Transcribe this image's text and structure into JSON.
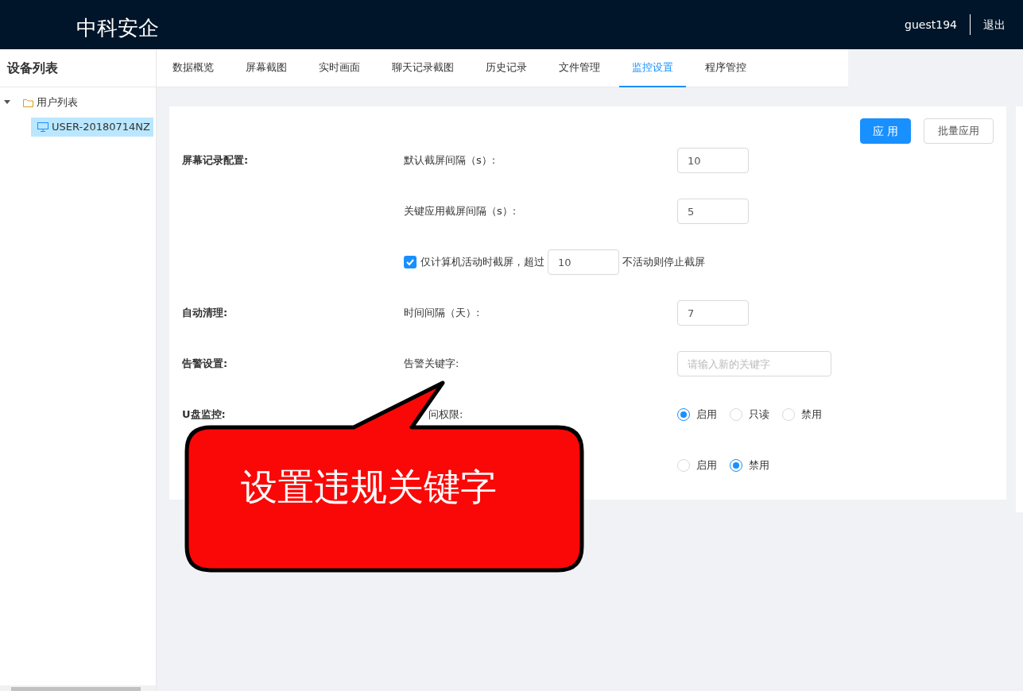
{
  "header": {
    "brand": "中科安企",
    "user": "guest194",
    "logout": "退出"
  },
  "sidebar": {
    "title": "设备列表",
    "tree": [
      {
        "label": "用户列表",
        "expanded": true,
        "children": [
          {
            "label": "USER-20180714NZ",
            "selected": true
          }
        ]
      }
    ]
  },
  "tabs": [
    {
      "label": "数据概览",
      "selected": false
    },
    {
      "label": "屏幕截图",
      "selected": false
    },
    {
      "label": "实时画面",
      "selected": false
    },
    {
      "label": "聊天记录截图",
      "selected": false
    },
    {
      "label": "历史记录",
      "selected": false
    },
    {
      "label": "文件管理",
      "selected": false
    },
    {
      "label": "监控设置",
      "selected": true
    },
    {
      "label": "程序管控",
      "selected": false
    }
  ],
  "actions": [
    {
      "label": "应 用",
      "kind": "primary"
    },
    {
      "label": "批量应用",
      "kind": "default"
    }
  ],
  "rows": [
    {
      "section": "屏幕记录配置:",
      "label": "默认截屏间隔（s）:",
      "kind": "input",
      "value": "10"
    },
    {
      "label": "关键应用截屏间隔（s）:",
      "kind": "input",
      "value": "5"
    },
    {
      "kind": "checkbox",
      "checked": true,
      "text_before": "仅计算机活动时截屏，超过",
      "value": "10",
      "text_after": "不活动则停止截屏"
    },
    {
      "section": "自动清理:",
      "label": "时间间隔（天）:",
      "kind": "input",
      "value": "7"
    },
    {
      "section": "告警设置:",
      "label": "告警关键字:",
      "kind": "keyword",
      "placeholder": "请输入新的关键字"
    },
    {
      "section": "U盘监控:",
      "label": "问权限:",
      "kind": "radio",
      "options": [
        {
          "label": "启用",
          "selected": true
        },
        {
          "label": "只读",
          "selected": false
        },
        {
          "label": "禁用",
          "selected": false
        }
      ]
    },
    {
      "kind": "radio",
      "options": [
        {
          "label": "启用",
          "selected": false
        },
        {
          "label": "禁用",
          "selected": true
        }
      ]
    }
  ],
  "callout": {
    "text": "设置违规关键字"
  }
}
